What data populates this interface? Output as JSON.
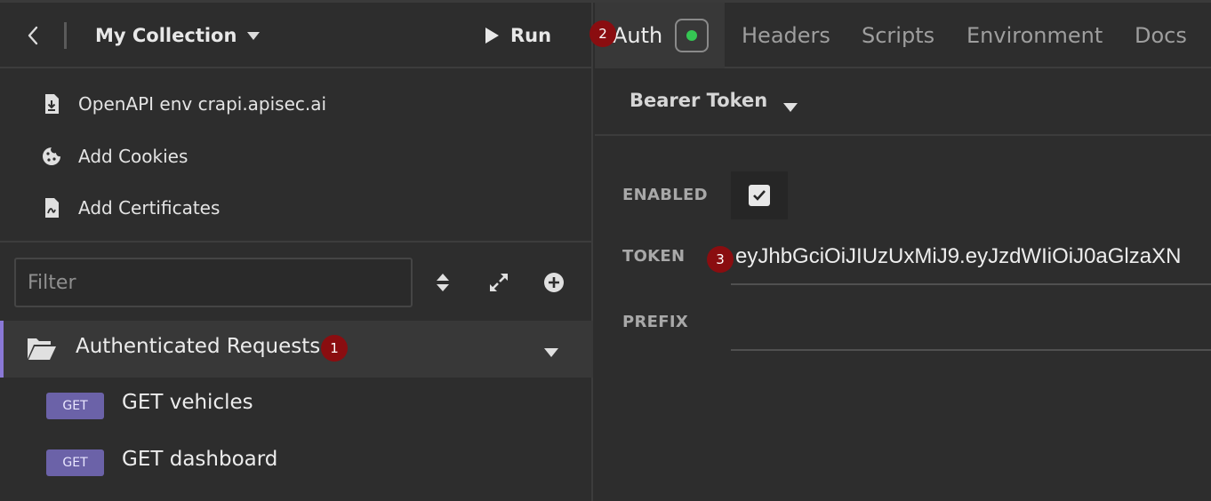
{
  "header": {
    "collection_name": "My Collection",
    "run_label": "Run"
  },
  "meta_items": [
    {
      "label": "OpenAPI env crapi.apisec.ai",
      "icon": "file-import-icon"
    },
    {
      "label": "Add Cookies",
      "icon": "cookie-icon"
    },
    {
      "label": "Add Certificates",
      "icon": "certificate-icon"
    }
  ],
  "filter": {
    "placeholder": "Filter"
  },
  "folder": {
    "label": "Authenticated Requests",
    "badge": "1"
  },
  "requests": [
    {
      "method": "GET",
      "label": "GET vehicles"
    },
    {
      "method": "GET",
      "label": "GET dashboard"
    }
  ],
  "tabs": [
    {
      "label": "Auth",
      "badge": "2"
    },
    {
      "label": "Headers"
    },
    {
      "label": "Scripts"
    },
    {
      "label": "Environment"
    },
    {
      "label": "Docs"
    }
  ],
  "auth": {
    "type": "Bearer Token",
    "enabled_label": "ENABLED",
    "enabled": true,
    "token_label": "TOKEN",
    "token_value": "eyJhbGciOiJIUzUxMiJ9.eyJzdWIiOiJ0aGlzaXN",
    "token_badge": "3",
    "prefix_label": "PREFIX",
    "prefix_value": ""
  },
  "colors": {
    "accent": "#8a78d6",
    "method_badge": "#6b62a8",
    "status_dot": "#35c653",
    "annotation_badge": "#8a0d10"
  }
}
